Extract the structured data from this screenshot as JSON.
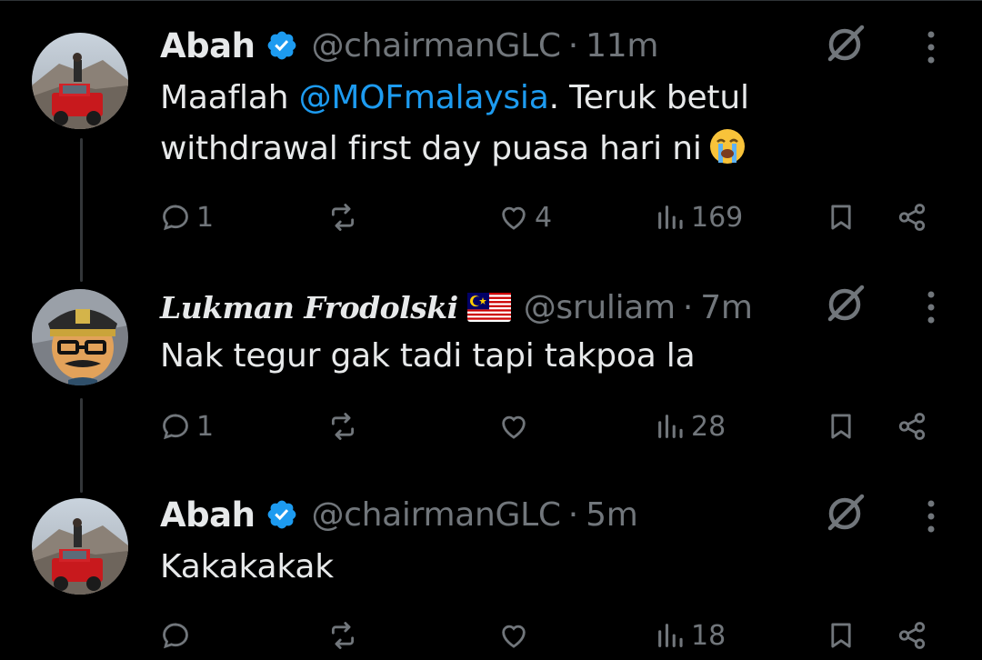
{
  "tweets": [
    {
      "name": "Abah",
      "handle": "@chairmanGLC",
      "separator": "·",
      "time": "11m",
      "text_before": "Maaflah ",
      "mention": "@MOFmalaysia",
      "text_after": ". Teruk betul withdrawal first day puasa hari ni",
      "emoji": "loudly-crying-face-emoji",
      "verified": true,
      "replies": "1",
      "reposts": "",
      "likes": "4",
      "views": "169"
    },
    {
      "name": "Lukman Frodolski",
      "flag": "malaysia-flag",
      "handle": "@sruliam",
      "separator": "·",
      "time": "7m",
      "text": "Nak tegur gak tadi tapi takpoa la",
      "replies": "1",
      "reposts": "",
      "likes": "",
      "views": "28"
    },
    {
      "name": "Abah",
      "handle": "@chairmanGLC",
      "separator": "·",
      "time": "5m",
      "text": "Kakakakak",
      "verified": true,
      "replies": "",
      "reposts": "",
      "likes": "",
      "views": "18"
    }
  ],
  "colors": {
    "background": "#000000",
    "text": "#e7e9ea",
    "secondary": "#71767b",
    "accent": "#1d9bf0",
    "thread_line": "#333639"
  },
  "icons": [
    "reply-icon",
    "repost-icon",
    "like-icon",
    "views-icon",
    "bookmark-icon",
    "share-icon",
    "grok-icon",
    "more-icon",
    "verified-badge-icon"
  ]
}
